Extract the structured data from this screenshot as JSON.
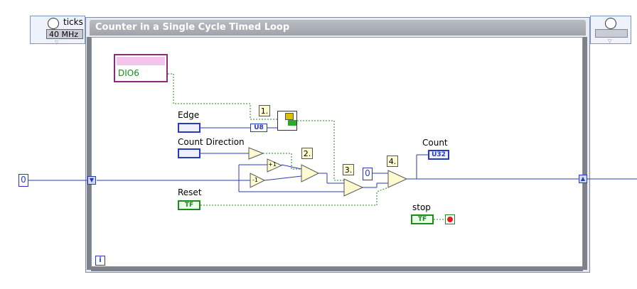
{
  "loop": {
    "title": "Counter in a Single Cycle Timed Loop",
    "input_node": {
      "label": "ticks",
      "clock": "40 MHz"
    },
    "iteration_terminal": "i"
  },
  "dio": {
    "name": "DIO6"
  },
  "controls": {
    "edge": "Edge",
    "count_direction": "Count Direction",
    "reset": "Reset",
    "stop": "stop",
    "count": "Count",
    "reset_term": "TF",
    "stop_term": "TF",
    "count_type": "U32",
    "edge_type": "U8"
  },
  "constants": {
    "initial": "0",
    "reset_value": "0",
    "inc": "+1",
    "dec": "-1"
  },
  "notes": [
    "1.",
    "2.",
    "3.",
    "4."
  ],
  "colors": {
    "numeric_wire": "#2a3bb8",
    "boolean_wire": "#1e8a1e",
    "io_wire": "#1e8a1e",
    "frame": "#7e8187"
  }
}
